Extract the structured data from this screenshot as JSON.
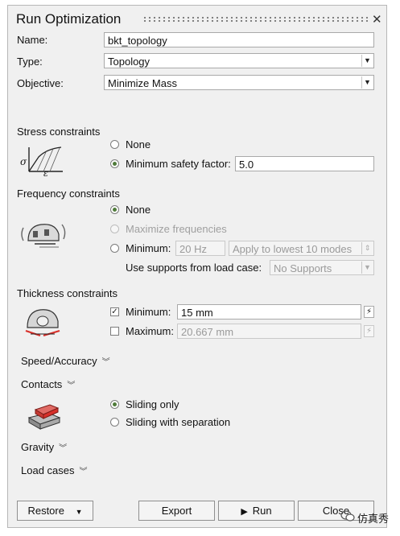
{
  "window": {
    "title": "Run Optimization",
    "close_glyph": "✕"
  },
  "fields": {
    "name_label": "Name:",
    "name_value": "bkt_topology",
    "type_label": "Type:",
    "type_value": "Topology",
    "objective_label": "Objective:",
    "objective_value": "Minimize Mass"
  },
  "stress": {
    "header": "Stress constraints",
    "icon_symbols": {
      "sigma": "σ",
      "epsilon": "ε"
    },
    "opt_none": "None",
    "opt_min_sf": "Minimum safety factor:",
    "sf_value": "5.0",
    "selected": "min_sf"
  },
  "frequency": {
    "header": "Frequency constraints",
    "opt_none": "None",
    "opt_maximize": "Maximize frequencies",
    "opt_minimum": "Minimum:",
    "min_value": "20 Hz",
    "apply_value": "Apply to lowest 10 modes",
    "supports_label": "Use supports from load case:",
    "supports_value": "No Supports",
    "selected": "none"
  },
  "thickness": {
    "header": "Thickness constraints",
    "min_label": "Minimum:",
    "min_value": "15 mm",
    "min_checked": true,
    "max_label": "Maximum:",
    "max_value": "20.667 mm",
    "max_checked": false
  },
  "sections": {
    "speed": "Speed/Accuracy",
    "contacts": "Contacts",
    "gravity": "Gravity",
    "load_cases": "Load cases"
  },
  "contacts": {
    "opt_sliding": "Sliding only",
    "opt_separation": "Sliding with separation",
    "selected": "sliding"
  },
  "buttons": {
    "restore": "Restore",
    "export": "Export",
    "run": "Run",
    "close": "Close"
  },
  "watermark": {
    "text": "仿真秀"
  },
  "colors": {
    "panel_bg": "#f0f0f0",
    "radio_selected": "#4f7b3a",
    "accent_red": "#d8302a"
  }
}
